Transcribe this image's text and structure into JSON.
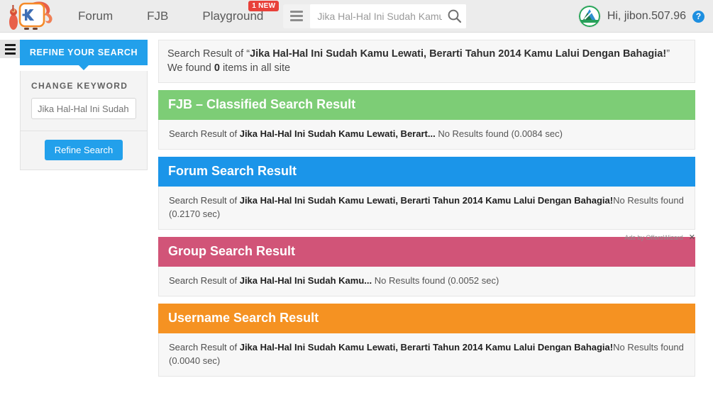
{
  "header": {
    "nav": [
      {
        "label": "Forum",
        "badge": ""
      },
      {
        "label": "FJB",
        "badge": ""
      },
      {
        "label": "Playground",
        "badge": "1 NEW"
      }
    ],
    "search": {
      "value": "Jika Hal-Hal Ini Sudah Kamu Le",
      "placeholder": "Jika Hal-Hal Ini Sudah Kamu Le",
      "icon": "search-icon"
    },
    "menu_icon": "hamburger-icon",
    "user": {
      "greeting": "Hi, jibon.507.96",
      "help": "?",
      "avatar_icon": "avatar-image"
    }
  },
  "sidebar": {
    "toggle_icon": "hamburger-icon",
    "refine_title": "REFINE YOUR SEARCH",
    "change_keyword_label": "CHANGE KEYWORD",
    "keyword_value": "Jika Hal-Hal Ini Sudah",
    "keyword_placeholder": "Jika Hal-Hal Ini Sudah",
    "refine_button": "Refine Search"
  },
  "main": {
    "summary": {
      "prefix": "Search Result of “",
      "query": "Jika Hal-Hal Ini Sudah Kamu Lewati, Berarti Tahun 2014 Kamu Lalui Dengan Bahagia!",
      "middle": "” We found ",
      "count": "0",
      "suffix": " items in all site"
    },
    "sections": [
      {
        "title": "FJB – Classified Search Result",
        "color": "#7dcd76",
        "prefix": "Search Result of ",
        "query": "Jika Hal-Hal Ini Sudah Kamu Lewati, Berart...",
        "status": "No Results found (0.0084 sec)"
      },
      {
        "title": "Forum Search Result",
        "color": "#1b95e9",
        "prefix": "Search Result of ",
        "query": "Jika Hal-Hal Ini Sudah Kamu Lewati, Berarti Tahun 2014 Kamu Lalui Dengan Bahagia!",
        "status": "No Results found (0.2170 sec)"
      },
      {
        "title": "Group Search Result",
        "color": "#d15478",
        "prefix": "Search Result of ",
        "query": "Jika Hal-Hal Ini Sudah Kamu...",
        "status": "No Results found (0.0052 sec)"
      },
      {
        "title": "Username Search Result",
        "color": "#f59222",
        "prefix": "Search Result of ",
        "query": "Jika Hal-Hal Ini Sudah Kamu Lewati, Berarti Tahun 2014 Kamu Lalui Dengan Bahagia!",
        "status": "No Results found (0.0040 sec)"
      }
    ],
    "ads": {
      "label": "Ads by OffersWizard",
      "close": "✕"
    }
  }
}
